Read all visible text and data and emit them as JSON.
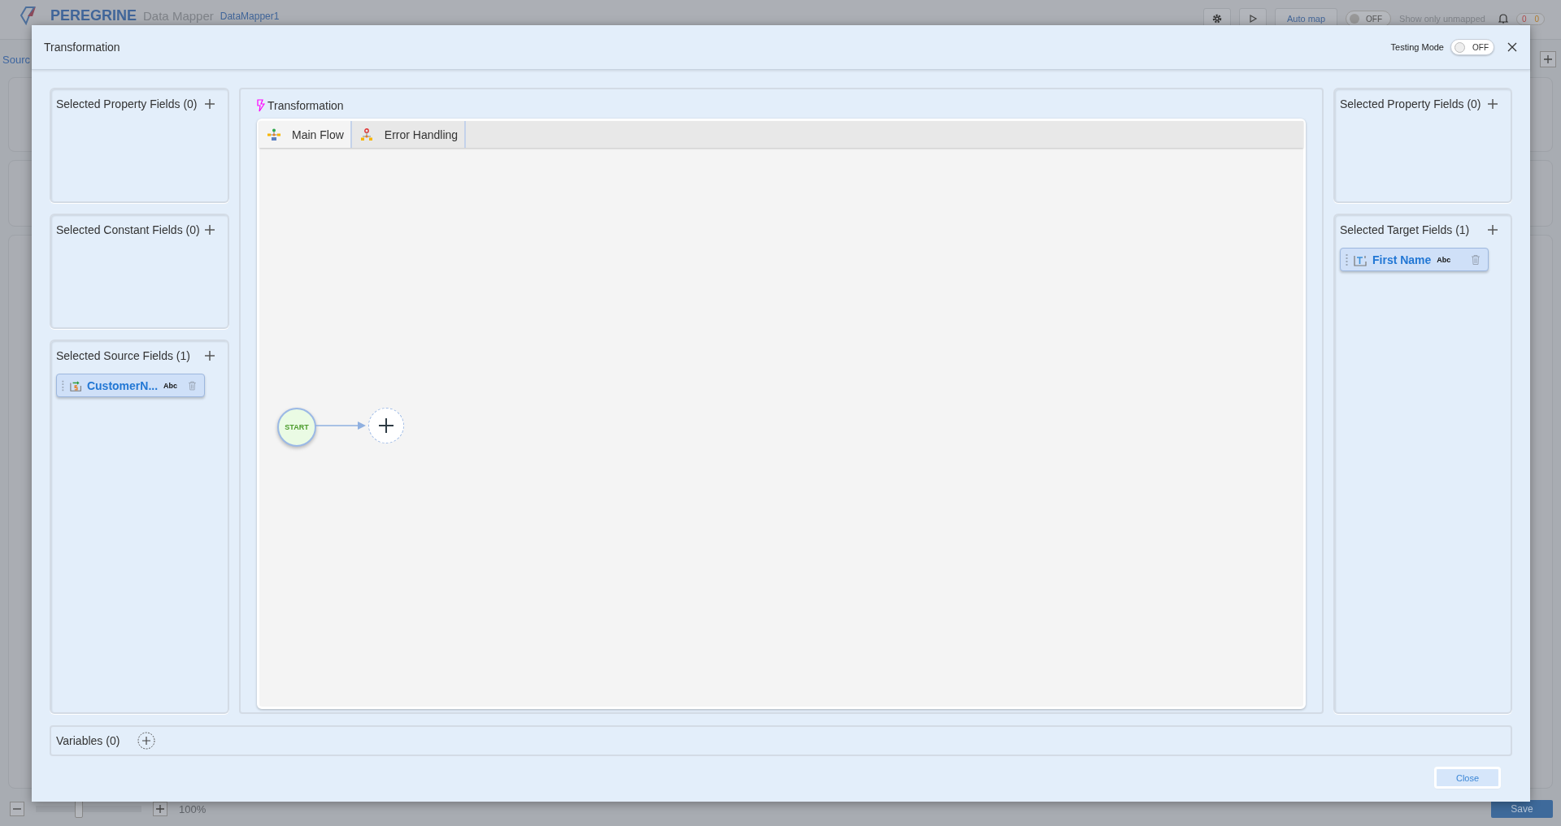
{
  "app": {
    "logo": "PEREGRINE",
    "title": "Data Mapper",
    "project": "DataMapper1",
    "auto_map": "Auto map",
    "unmapped_toggle": {
      "label": "OFF",
      "on": false
    },
    "unmapped_label": "Show only unmapped",
    "counts": [
      "0",
      "0"
    ],
    "source_tab": "Sourc",
    "zoom": {
      "level": 0.4,
      "reading": "100%"
    },
    "save": "Save"
  },
  "dialog": {
    "title": "Transformation",
    "testing_mode": {
      "label": "Testing Mode",
      "state": "OFF",
      "on": false
    },
    "left_panels": [
      {
        "title": "Selected Property Fields (0)"
      },
      {
        "title": "Selected Constant Fields (0)"
      },
      {
        "title": "Selected Source Fields (1)",
        "fields": [
          {
            "kind": "source",
            "name": "CustomerN...",
            "type": "Abc"
          }
        ]
      }
    ],
    "center": {
      "title": "Transformation",
      "tabs": [
        {
          "label": "Main Flow",
          "selected": true,
          "kind": "main"
        },
        {
          "label": "Error Handling",
          "selected": false,
          "kind": "error"
        }
      ],
      "start_node": "START"
    },
    "right_panels": [
      {
        "title": "Selected Property Fields (0)"
      },
      {
        "title": "Selected Target Fields (1)",
        "fields": [
          {
            "kind": "target",
            "name": "First Name",
            "type": "Abc"
          }
        ]
      }
    ],
    "variables": {
      "label": "Variables (0)"
    },
    "close": "Close"
  }
}
